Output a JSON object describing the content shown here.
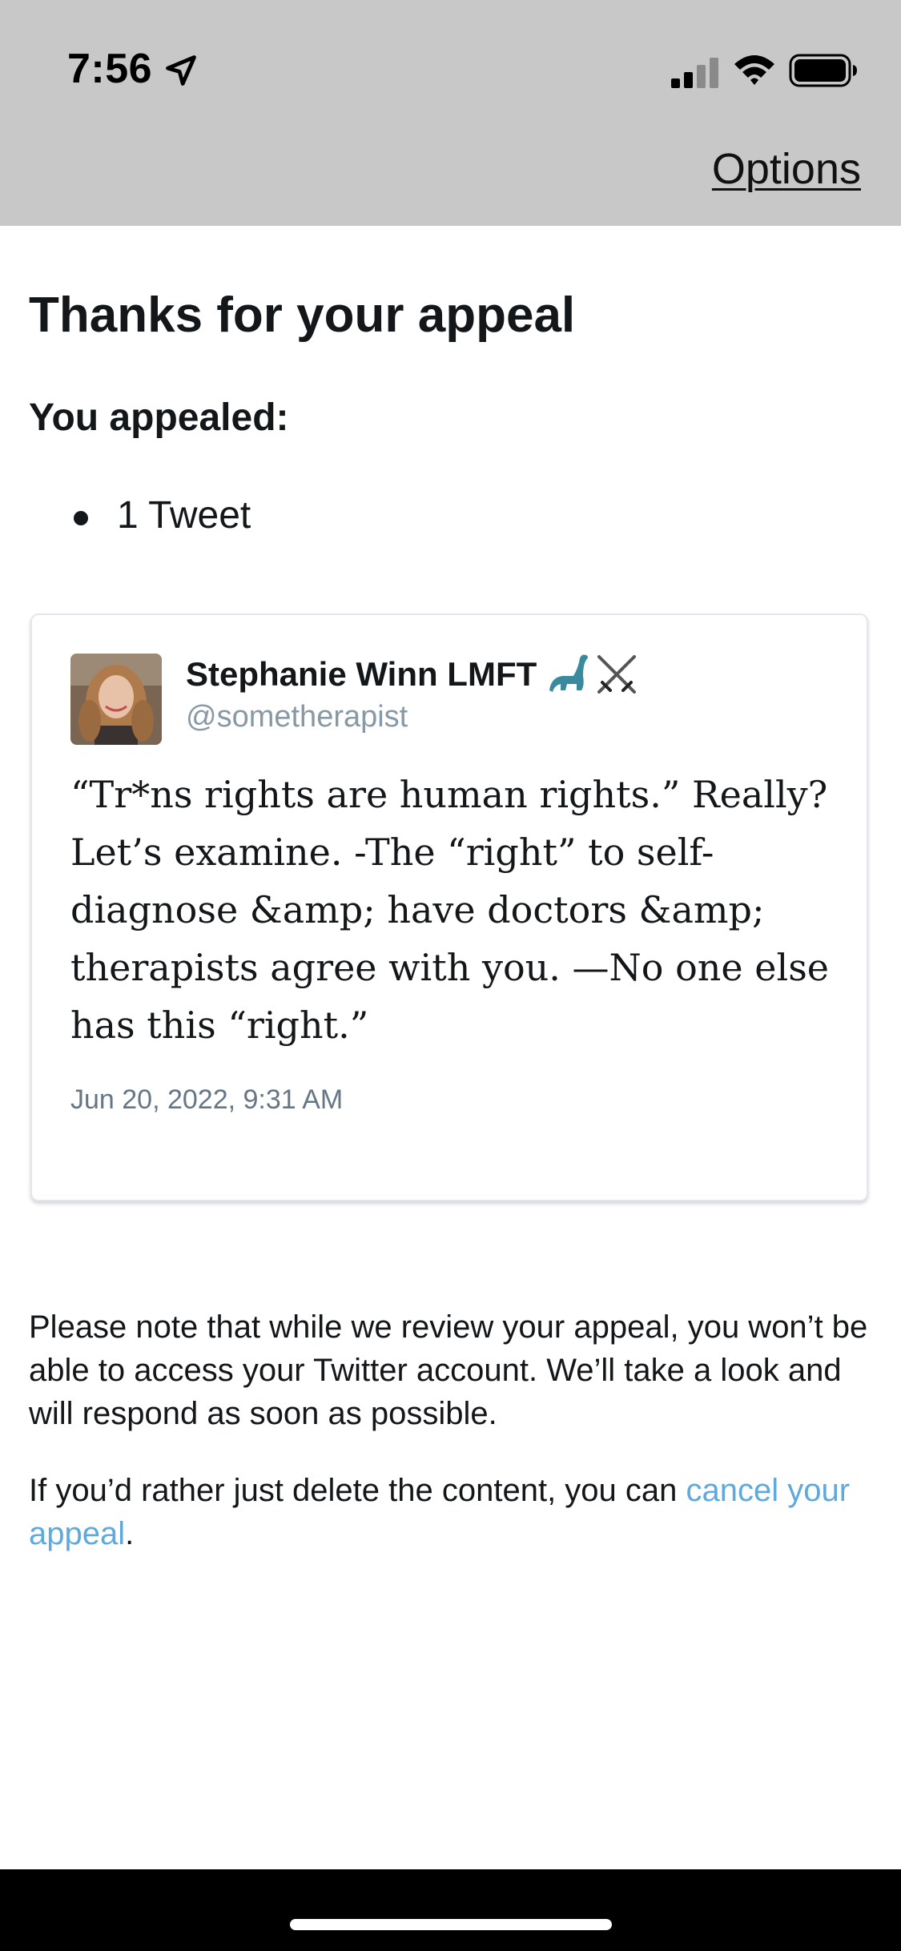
{
  "status_bar": {
    "time": "7:56"
  },
  "nav": {
    "options_label": "Options"
  },
  "main": {
    "title": "Thanks for your appeal",
    "appealed_label": "You appealed:",
    "appealed_items": [
      "1 Tweet"
    ]
  },
  "tweet": {
    "author_name": "Stephanie Winn LMFT",
    "author_emojis": [
      "sauropod-icon",
      "crossed-swords-icon"
    ],
    "handle": "@sometherapist",
    "text": "“Tr*ns rights are human rights.” Really? Let’s examine. -The “right” to self-diagnose &amp; have doctors &amp; therapists agree with you. —No one else has this “right.”",
    "date": "Jun 20, 2022, 9:31 AM"
  },
  "notes": {
    "review_note": "Please note that while we review your appeal, you won’t be able to access your Twitter account. We’ll take a look and will respond as soon as possible.",
    "delete_prefix": "If you’d rather just delete the content, you can ",
    "cancel_link": "cancel your appeal",
    "delete_suffix": "."
  },
  "colors": {
    "top_bar_bg": "#c8c8c8",
    "link": "#5ea9dd",
    "handle": "#8899a6",
    "text": "#14171a"
  }
}
